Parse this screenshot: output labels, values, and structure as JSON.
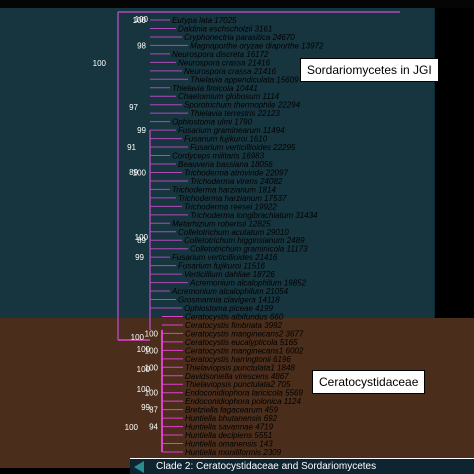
{
  "clade_labels": {
    "sordariomycetes": "Sordariomycetes in JGI",
    "ceratocystidaceae": "Ceratocystidaceae"
  },
  "caption": "Clade 2: Ceratocystidaceae and Sordariomycetes",
  "colors": {
    "sordariomycetes_band": "#17353f",
    "ceratocystidaceae_band": "#4a2d1b",
    "branch_main": "#b04ab8",
    "branch_cera": "#e040d0",
    "taxon_text": "#000000",
    "support_text": "#ffffff"
  },
  "taxa": [
    {
      "name": "Eutypa lata 17025",
      "support": "100"
    },
    {
      "name": "Daldinia eschscholzii 3161",
      "support": ""
    },
    {
      "name": "Cryphonectria parasitica 24670",
      "support": ""
    },
    {
      "name": "Magnaporthe oryzae diaporthe 13972",
      "support": "98"
    },
    {
      "name": "Neurospora discreta 16172",
      "support": ""
    },
    {
      "name": "Neurospora crassa 21416",
      "support": ""
    },
    {
      "name": "Neurospora crassa 21416",
      "support": ""
    },
    {
      "name": "Thielavia appendiculata 15609",
      "support": ""
    },
    {
      "name": "Thielavia fimicola 10441",
      "support": ""
    },
    {
      "name": "Chaetomium globosum 1114",
      "support": ""
    },
    {
      "name": "Sporotrichum thermophile 22294",
      "support": ""
    },
    {
      "name": "Thielavia terrestris 22123",
      "support": ""
    },
    {
      "name": "Ophiostoma ulmi 1790",
      "support": ""
    },
    {
      "name": "Fusarium graminearum 11494",
      "support": "99"
    },
    {
      "name": "Fusarium fujikuroi 1610",
      "support": ""
    },
    {
      "name": "Fusarium verticillioides 22295",
      "support": ""
    },
    {
      "name": "Cordyceps militaris 16983",
      "support": ""
    },
    {
      "name": "Beauveria bassiana 18056",
      "support": ""
    },
    {
      "name": "Trichoderma atroviride 22097",
      "support": "100"
    },
    {
      "name": "Trichoderma virens 24082",
      "support": ""
    },
    {
      "name": "Trichoderma harzianum 1814",
      "support": ""
    },
    {
      "name": "Trichoderma harzianum 17537",
      "support": ""
    },
    {
      "name": "Trichoderma reesei 19922",
      "support": ""
    },
    {
      "name": "Trichoderma longibrachiatum 31434",
      "support": ""
    },
    {
      "name": "Metarhizium robertsii 12825",
      "support": ""
    },
    {
      "name": "Colletotrichum acutatum 29010",
      "support": ""
    },
    {
      "name": "Colletotrichum higginsianum 2489",
      "support": "89"
    },
    {
      "name": "Colletotrichum graminicola 11173",
      "support": ""
    },
    {
      "name": "Fusarium verticillioides 21416",
      "support": ""
    },
    {
      "name": "Fusarium fujikuroi 11516",
      "support": ""
    },
    {
      "name": "Verticillium dahliae 18726",
      "support": ""
    },
    {
      "name": "Acremonium alcalophilum 19852",
      "support": ""
    },
    {
      "name": "Acremonium alcalophilum 21054",
      "support": ""
    },
    {
      "name": "Grosmannia clavigera 14118",
      "support": ""
    },
    {
      "name": "Ophiostoma piceae 4199",
      "support": ""
    },
    {
      "name": "Ceratocystis albifundus 660",
      "support": ""
    },
    {
      "name": "Ceratocystis fimbriata 3992",
      "support": ""
    },
    {
      "name": "Ceratocystis manginecans2 3677",
      "support": "100"
    },
    {
      "name": "Ceratocystis eucalypticola 5165",
      "support": ""
    },
    {
      "name": "Ceratocystis manginecans1 6002",
      "support": "100"
    },
    {
      "name": "Ceratocystis harringtonii 6196",
      "support": ""
    },
    {
      "name": "Thielaviopsis punctulata1 1848",
      "support": "100"
    },
    {
      "name": "Davidsoniella virescens 4867",
      "support": ""
    },
    {
      "name": "Thielaviopsis punctulata2 705",
      "support": ""
    },
    {
      "name": "Endoconidiophora laricicola 5569",
      "support": "100"
    },
    {
      "name": "Endoconidiophora polonica 1124",
      "support": ""
    },
    {
      "name": "Bretziella fagacearum 459",
      "support": "87"
    },
    {
      "name": "Huntiella bhutanensis 692",
      "support": ""
    },
    {
      "name": "Huntiella savannae 4719",
      "support": "94"
    },
    {
      "name": "Huntiella decipiens 5551",
      "support": ""
    },
    {
      "name": "Huntiella omanensis 143",
      "support": ""
    },
    {
      "name": "Huntiella moniliformis 2309",
      "support": ""
    }
  ],
  "node_supports": [
    "100",
    "100",
    "91",
    "100",
    "100",
    "89",
    "100",
    "100",
    "99",
    "100",
    "100",
    "97",
    "99"
  ]
}
